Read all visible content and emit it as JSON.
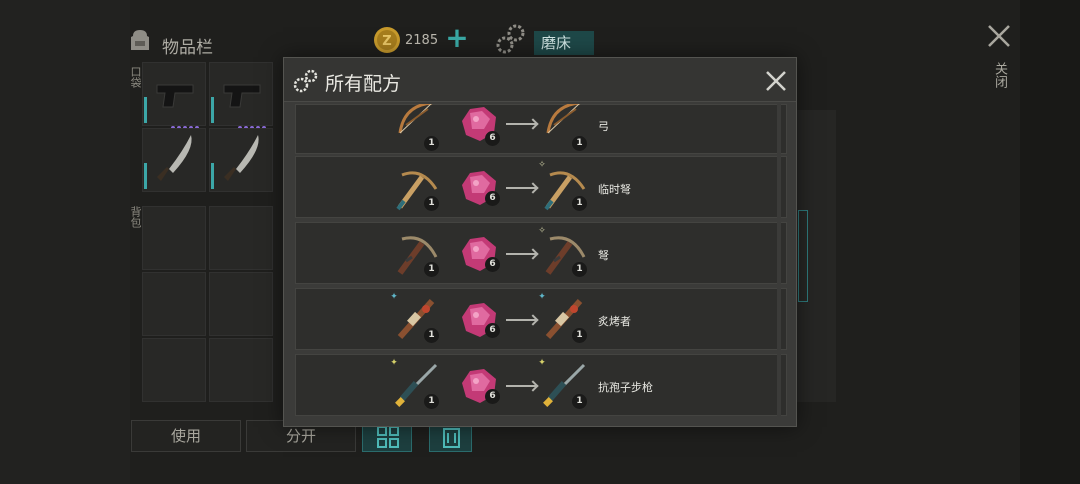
{
  "inventory": {
    "title": "物品栏",
    "pocket_label": "口袋",
    "backpack_label": "背包"
  },
  "currency": {
    "amount": "2185"
  },
  "top_tab": {
    "label": "磨床"
  },
  "close_side": {
    "label": "关闭"
  },
  "bottom_bar": {
    "use_label": "使用",
    "split_label": "分开"
  },
  "modal": {
    "title": "所有配方",
    "recipes": [
      {
        "name": "弓",
        "input_weapon": "bow",
        "input_qty": "1",
        "material_qty": "6",
        "output_qty": "1"
      },
      {
        "name": "临时弩",
        "input_weapon": "makeshift-crossbow",
        "input_qty": "1",
        "material_qty": "6",
        "output_qty": "1"
      },
      {
        "name": "弩",
        "input_weapon": "crossbow",
        "input_qty": "1",
        "material_qty": "6",
        "output_qty": "1"
      },
      {
        "name": "炙烤者",
        "input_weapon": "flamethrower",
        "input_qty": "1",
        "material_qty": "6",
        "output_qty": "1"
      },
      {
        "name": "抗孢子步枪",
        "input_weapon": "spore-rifle",
        "input_qty": "1",
        "material_qty": "6",
        "output_qty": "1"
      }
    ]
  },
  "colors": {
    "accent_teal": "#3aa9a5",
    "material_pink": "#d6417f",
    "coin_gold": "#c79a2c"
  }
}
